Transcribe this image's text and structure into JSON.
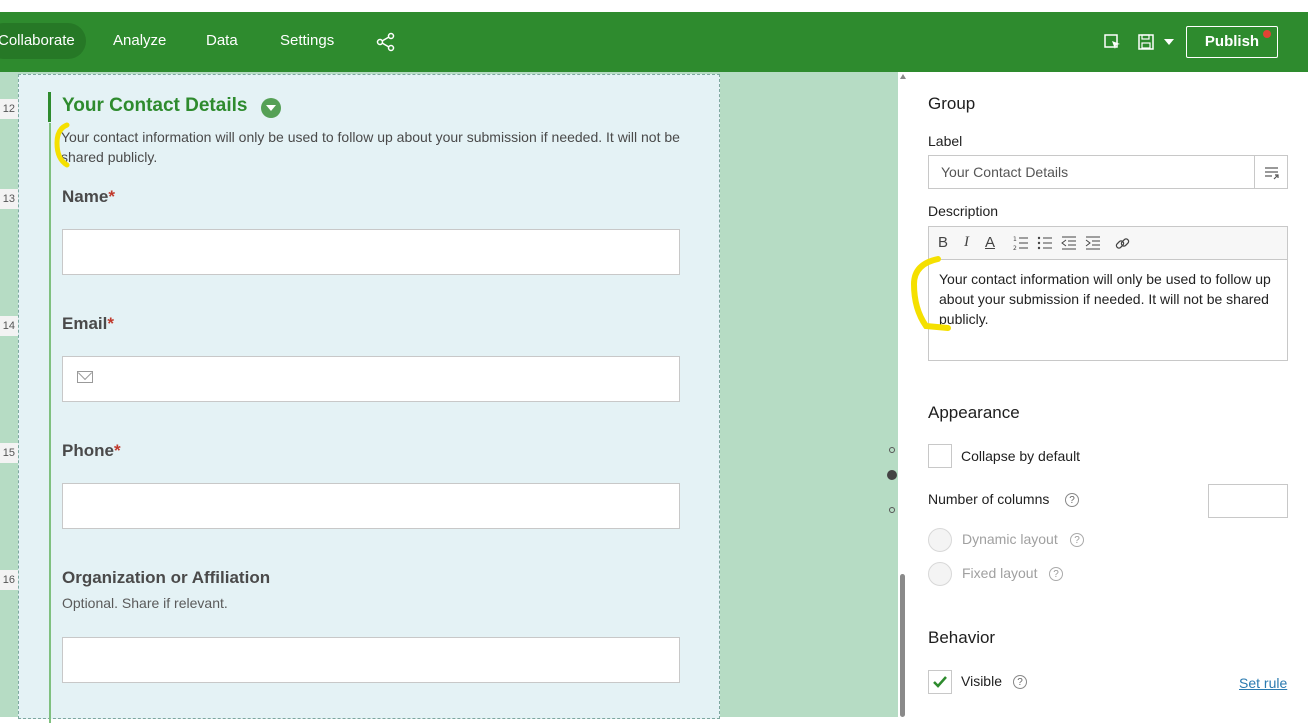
{
  "topbar": {
    "tabs": [
      "Collaborate",
      "Analyze",
      "Data",
      "Settings"
    ],
    "publish_label": "Publish"
  },
  "canvas": {
    "line_numbers": [
      "12",
      "13",
      "14",
      "15",
      "16"
    ],
    "group": {
      "title": "Your Contact Details",
      "description": "Your contact information will only be used to follow up about your submission if needed. It will not be shared publicly."
    },
    "fields": [
      {
        "label": "Name",
        "required": "*"
      },
      {
        "label": "Email",
        "required": "*"
      },
      {
        "label": "Phone",
        "required": "*"
      },
      {
        "label": "Organization or Affiliation",
        "hint": "Optional. Share if relevant."
      }
    ]
  },
  "panel": {
    "header": "Group",
    "label_title": "Label",
    "label_value": "Your Contact Details",
    "description_title": "Description",
    "toolbar": {
      "bold": "B",
      "italic": "I",
      "color": "A"
    },
    "description_value": "Your contact information will only be used to follow up about your submission if needed. It will not be shared publicly.",
    "appearance": {
      "title": "Appearance",
      "collapse": "Collapse by default",
      "columns": "Number of columns",
      "dynamic": "Dynamic layout",
      "fixed": "Fixed layout"
    },
    "behavior": {
      "title": "Behavior",
      "visible": "Visible",
      "set_rule": "Set rule"
    }
  },
  "colors": {
    "brand": "#2e8b2e",
    "highlight": "#f5e000",
    "required": "#c0392b"
  }
}
